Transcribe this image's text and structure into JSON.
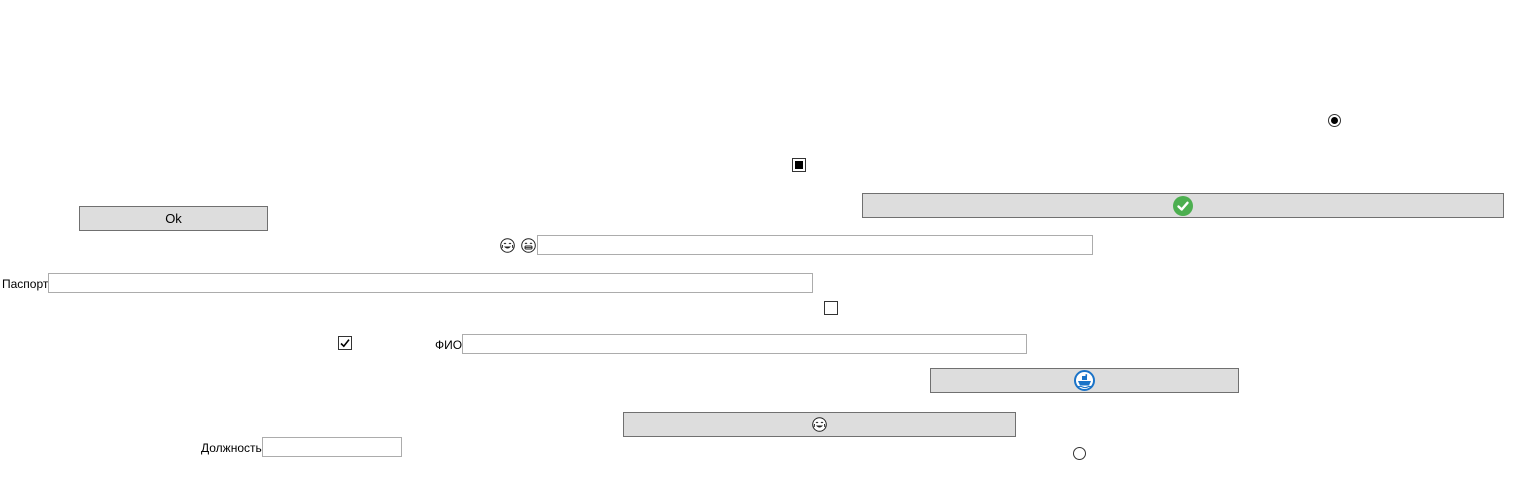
{
  "ok_button": {
    "label": "Ok"
  },
  "passport": {
    "label": "Паспорт",
    "value": ""
  },
  "fio": {
    "label": "ФИО",
    "value": ""
  },
  "position": {
    "label": "Должность",
    "value": ""
  },
  "emoji_input": {
    "value": ""
  },
  "controls": {
    "radio_top_checked": true,
    "checkbox_square_indeterminate": true,
    "checkbox_empty_checked": false,
    "checkbox_left_checked": true,
    "radio_bottom_checked": false
  },
  "icons": {
    "wide_button": "green-check-icon",
    "mid_button": "blue-ship-icon",
    "lower_button": "laughing-emoji-icon",
    "emoji_pair": [
      "laughing-emoji-icon",
      "grinning-emoji-icon"
    ]
  },
  "colors": {
    "button_bg": "#dddddd",
    "button_border": "#707070",
    "field_border": "#acacac",
    "check_green": "#4caf50",
    "ship_blue": "#1a73c8"
  }
}
